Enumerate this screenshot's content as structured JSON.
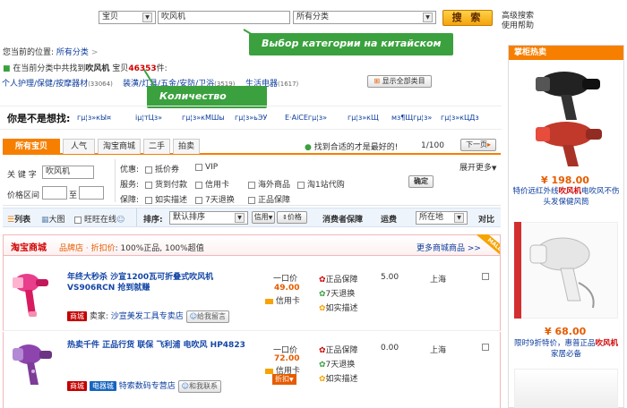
{
  "search": {
    "scope": "宝贝",
    "query": "吹风机",
    "category": "所有分类",
    "button": "搜 索",
    "advanced": "高级搜索",
    "help": "使用帮助"
  },
  "callouts": {
    "category": "Выбор категории на китайском",
    "count": "Количество"
  },
  "breadcrumb": {
    "prefix": "您当前的位置:",
    "link": "所有分类",
    "sep": ">"
  },
  "result_line": {
    "pre": "在当前分类中共找到",
    "keyword": "吹风机",
    "mid": "宝贝",
    "count": "46353",
    "post": "件:"
  },
  "categories": [
    {
      "label": "个人护理/保健/按摩器材",
      "count": "(33064)"
    },
    {
      "label": "装潢/灯具/五金/安防/卫浴",
      "count": "(3519)"
    },
    {
      "label": "生活电器",
      "count": "(1617)"
    }
  ],
  "show_all": "显示全部类目",
  "suggest": {
    "title": "你是不是想找:",
    "items": [
      "гµ¦з»кЫ¤",
      "іµ¦тЦз»",
      "гµ¦з»кМШы",
      "гµ¦з»ьЭУ",
      "Е·АiСЕгµ¦з»",
      "гµ¦з»кЩ",
      "мз¶Щгµ¦з»",
      "гµ¦з»кЦДз"
    ]
  },
  "tabs": {
    "all": "所有宝贝",
    "popular": "人气",
    "mall": "淘宝商城",
    "second": "二手",
    "auction": "拍卖",
    "hint": "找到合适的才是最好的!",
    "page": "1/100",
    "next": "下一页"
  },
  "filters": {
    "keyword_label": "关 键 字",
    "keyword_value": "吹风机",
    "price_label": "价格区间",
    "to": "至",
    "promo_label": "优惠:",
    "promo": [
      "抵价券",
      "VIP"
    ],
    "service_label": "服务:",
    "service": [
      "货到付款",
      "信用卡",
      "海外商品",
      "淘1站代购"
    ],
    "guarantee_label": "保障:",
    "guarantee": [
      "如实描述",
      "7天退换",
      "正品保障"
    ],
    "expand": "展开更多",
    "confirm": "确定"
  },
  "sortbar": {
    "list": "列表",
    "grid": "大图",
    "wangwang": "旺旺在线",
    "sort_label": "排序:",
    "sort_value": "默认排序",
    "credit": "信用",
    "price": "价格",
    "guarantee": "消费者保障",
    "shipping": "运费",
    "location": "所在地",
    "compare": "对比"
  },
  "mall": {
    "logo": "淘宝商城",
    "desc_a": "品牌店",
    "desc_b": "折扣价",
    "desc_c": ": 100%正品, 100%超值",
    "more": "更多商城商品 >>",
    "tag": "MALL"
  },
  "products": [
    {
      "title": "年终大秒杀 沙宣1200瓦可折叠式吹风机 VS906RCN 抢到就赚",
      "seller_label": "卖家:",
      "seller": "沙宣美发工具专卖店",
      "contact": "给我留言",
      "price_label": "一口价",
      "price": "49.00",
      "card": "信用卡",
      "g1": "正品保障",
      "g2": "7天退换",
      "g3": "如实描述",
      "shipping": "5.00",
      "location": "上海",
      "badge1": "商城"
    },
    {
      "title": "热卖千件 正品行货 联保 飞利浦 电吹风 HP4823",
      "seller": "特索数码专营店",
      "contact": "和我联系",
      "price_label": "一口价",
      "price": "72.00",
      "card": "信用卡",
      "discount": "折扣",
      "g1": "正品保障",
      "g2": "7天退换",
      "g3": "如实描述",
      "shipping": "0.00",
      "location": "上海",
      "badge1": "商城",
      "badge2": "电器城"
    }
  ],
  "sidebar": {
    "title": "掌柜热卖",
    "items": [
      {
        "price": "¥ 198.00",
        "caption_a": "特价远红外线",
        "caption_b": "吹风机",
        "caption_c": "电吹风不伤头发保健风筒"
      },
      {
        "price": "¥ 68.00",
        "caption_a": "限时9折特价，惠普正品",
        "caption_b": "吹风机",
        "caption_c": "家居必备"
      }
    ]
  },
  "colors": {
    "accent": "#f77f00",
    "callout": "#3aa13e",
    "link": "#0b3c9d",
    "price": "#e65c00"
  }
}
